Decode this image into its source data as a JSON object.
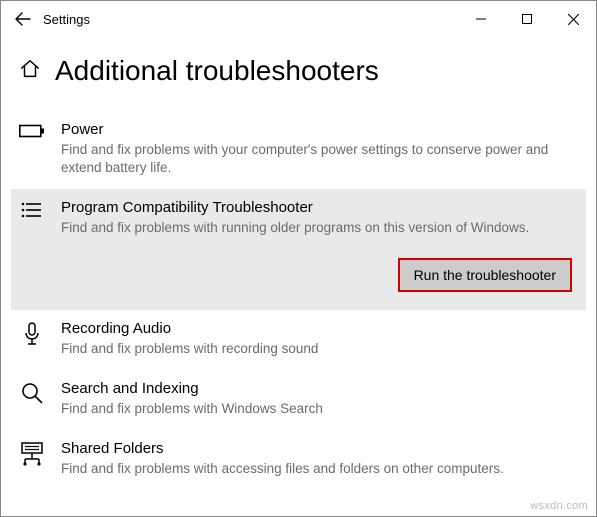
{
  "window": {
    "title": "Settings"
  },
  "page": {
    "heading": "Additional troubleshooters"
  },
  "troubleshooters": [
    {
      "title": "Power",
      "desc": "Find and fix problems with your computer's power settings to conserve power and extend battery life."
    },
    {
      "title": "Program Compatibility Troubleshooter",
      "desc": "Find and fix problems with running older programs on this version of Windows.",
      "run_label": "Run the troubleshooter"
    },
    {
      "title": "Recording Audio",
      "desc": "Find and fix problems with recording sound"
    },
    {
      "title": "Search and Indexing",
      "desc": "Find and fix problems with Windows Search"
    },
    {
      "title": "Shared Folders",
      "desc": "Find and fix problems with accessing files and folders on other computers."
    }
  ],
  "watermark": "wsxdn.com"
}
